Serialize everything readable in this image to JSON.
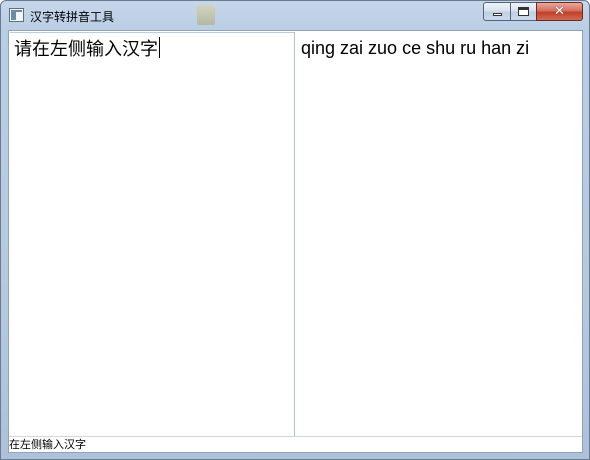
{
  "window": {
    "title": "汉字转拼音工具",
    "controls": {
      "minimize_icon": "minimize-icon",
      "maximize_icon": "maximize-icon",
      "close_icon": "close-icon",
      "close_color": "#c1402c"
    }
  },
  "left_pane": {
    "input_text": "请在左侧输入汉字"
  },
  "right_pane": {
    "output_text": "qing zai zuo ce shu ru han zi"
  },
  "status_bar": {
    "text": "在左侧输入汉字"
  },
  "colors": {
    "titlebar": "#b9cde4",
    "pane_divider": "#a9c3dc"
  }
}
